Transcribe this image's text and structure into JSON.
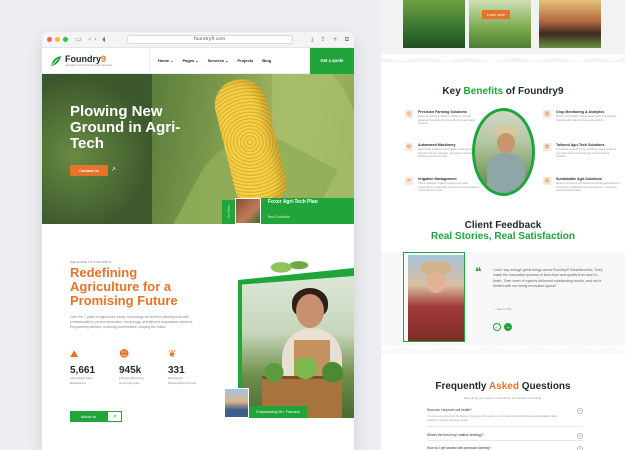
{
  "browser": {
    "url": "foundry9.com",
    "colors": {
      "red": "#ff5f57",
      "yellow": "#febc2e",
      "green": "#28c840"
    }
  },
  "brand": {
    "name_main": "Foundry",
    "name_accent": "9",
    "tagline": "Agriculture & Farming Services Template",
    "accent": "#1fa53a",
    "orange": "#e7732a"
  },
  "nav": {
    "items": [
      {
        "label": "Home"
      },
      {
        "label": "Pages"
      },
      {
        "label": "Services"
      },
      {
        "label": "Projects"
      },
      {
        "label": "Blog"
      }
    ],
    "cta": "Get a quote"
  },
  "hero": {
    "title": "Plowing New Ground in Agri-Tech",
    "button": "Contact us",
    "badge_title": "Foxer Agri-Tech Plan",
    "badge_sub": "Best Solutions",
    "vertical_tag": "Our Farm"
  },
  "about": {
    "welcome": "WELCOME TO FOUNDRY9",
    "title": "Redefining Agriculture for a Promising Future",
    "body": "Over the 7 years of agriculture &amp; technology we've been planting trust with professionalism, proven innovation, technology, and tailored sustainable solutions. Empowering farmers, nurturing communities, shaping the future.",
    "stats": [
      {
        "value": "5,661",
        "label": "Agricultural Plots Established"
      },
      {
        "value": "945k",
        "label": "Farmers Reaching Good Agri-Care"
      },
      {
        "value": "331",
        "label": "Ecofriendly Partnerships Formed"
      }
    ],
    "button": "About us",
    "employees_badge": "Empowering 2k+ Farmers"
  },
  "right": {
    "top_button": "Learn more",
    "benefits_title_pre": "Key ",
    "benefits_title_accent": "Benefits",
    "benefits_title_post": " of Foundry9",
    "benefits": [
      {
        "title": "Precision Farming Solutions",
        "desc": "Enhance yield and resource efficiency through advanced precision farming technology and smart systems."
      },
      {
        "title": "Automated Machinery",
        "desc": "Seamlessly integrated automated machinery and robotics with our expertise, designed to optimize farm efficiency across the field."
      },
      {
        "title": "Irrigation Management",
        "desc": "Utilize intelligent irrigation systems for water conservation, sustainable crops and precise moisture control all year round."
      },
      {
        "title": "Crop Monitoring & Analytics",
        "desc": "Monitor crop health, detect issues early and optimize harvests with real-time data and analytics."
      },
      {
        "title": "Tailored Agri-Tech Solutions",
        "desc": "Accelerate productivity by matching unique needs of your farm with customized agri-tech innovative solutions."
      },
      {
        "title": "Sustainable Agri-Solutions",
        "desc": "Explore innovative techniques and smart approaches to transforming traditional farming practices, minimizing environmental impact."
      }
    ],
    "feedback_title": "Client Feedback",
    "feedback_sub": "Real Stories, Real Satisfaction",
    "quote": "I can't say enough great things about Foundry9! Cleanfarm/Inc. They made the innovative process of farm-thus and quality from start to finish. Their team of experts delivered outstanding results, and we're thrilled with our newly renovated space!",
    "quote_name": "— Senior Milo",
    "faq_pre": "Frequently ",
    "faq_accent": "Asked",
    "faq_post": " Questions",
    "faq_sub": "Everything you need to know about the product and billing.",
    "faqs": [
      {
        "q": "How can I improve soil health?",
        "a": "You can use soil test kits for farmers. Our team will analyze our soil's data and provide the recommendations best suited for maximum farming results."
      },
      {
        "q": "What's the best crop rotation strategy?"
      },
      {
        "q": "How do I get started with precision farming?"
      }
    ]
  }
}
